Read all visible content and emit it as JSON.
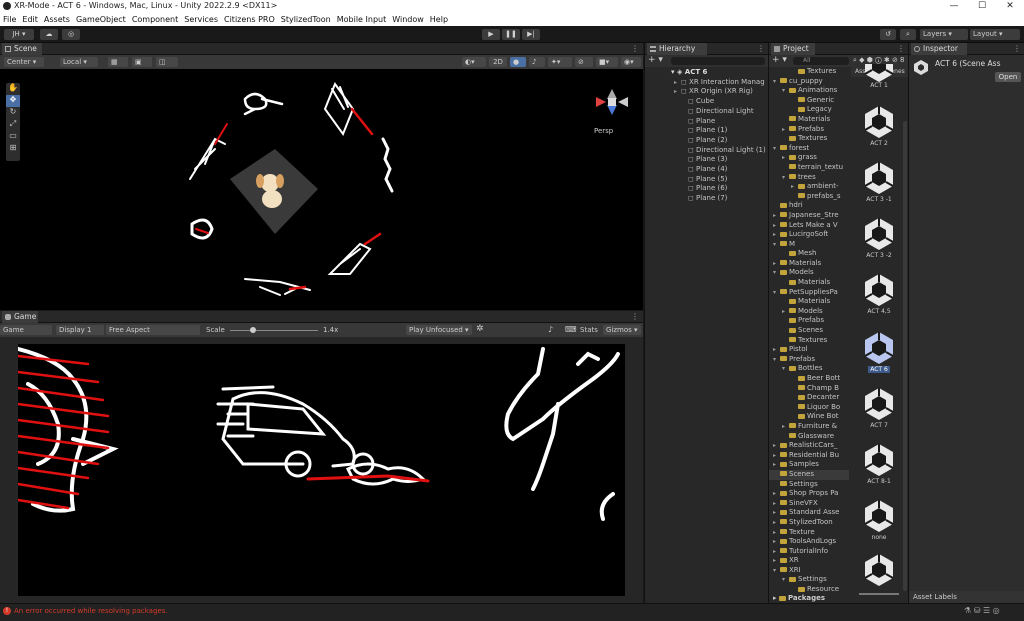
{
  "window": {
    "title": "XR-Mode - ACT 6 - Windows, Mac, Linux - Unity 2022.2.9 <DX11>"
  },
  "menu": [
    "File",
    "Edit",
    "Assets",
    "GameObject",
    "Component",
    "Services",
    "Citizens PRO",
    "StylizedToon",
    "Mobile Input",
    "Window",
    "Help"
  ],
  "toolbar": {
    "account": "JH ▾",
    "layers": "Layers",
    "layout": "Layout"
  },
  "scene": {
    "tab": "Scene",
    "pivot": "Center",
    "space": "Local",
    "mode_2d": "2D",
    "persp": "Persp"
  },
  "game": {
    "tab": "Game",
    "display_mode": "Game",
    "display": "Display 1",
    "aspect": "Free Aspect",
    "scale_label": "Scale",
    "scale_value": 1.4,
    "scale_text": "1.4x",
    "play_mode": "Play Unfocused",
    "stats": "Stats",
    "gizmos": "Gizmos"
  },
  "hierarchy": {
    "tab": "Hierarchy",
    "root": "ACT 6",
    "items": [
      "XR Interaction Manag",
      "XR Origin (XR Rig)",
      "Cube",
      "Directional Light",
      "Plane",
      "Plane (1)",
      "Plane (2)",
      "Directional Light (1)",
      "Plane (3)",
      "Plane (4)",
      "Plane (5)",
      "Plane (6)",
      "Plane (7)"
    ]
  },
  "project": {
    "tab": "Project",
    "search": "All",
    "breadcrumb": [
      "Assets",
      "Scenes"
    ],
    "tree": [
      {
        "label": "Textures",
        "d": 3,
        "a": ""
      },
      {
        "label": "cu_puppy",
        "d": 1,
        "a": "▾"
      },
      {
        "label": "Animations",
        "d": 2,
        "a": "▾"
      },
      {
        "label": "Generic",
        "d": 3,
        "a": ""
      },
      {
        "label": "Legacy",
        "d": 3,
        "a": ""
      },
      {
        "label": "Materials",
        "d": 2,
        "a": ""
      },
      {
        "label": "Prefabs",
        "d": 2,
        "a": "▸"
      },
      {
        "label": "Textures",
        "d": 2,
        "a": ""
      },
      {
        "label": "forest",
        "d": 1,
        "a": "▾"
      },
      {
        "label": "grass",
        "d": 2,
        "a": "▸"
      },
      {
        "label": "terrain_textu",
        "d": 2,
        "a": ""
      },
      {
        "label": "trees",
        "d": 2,
        "a": "▾"
      },
      {
        "label": "ambient-",
        "d": 3,
        "a": "▸"
      },
      {
        "label": "prefabs_s",
        "d": 3,
        "a": ""
      },
      {
        "label": "hdri",
        "d": 1,
        "a": ""
      },
      {
        "label": "Japanese_Stre",
        "d": 1,
        "a": "▸"
      },
      {
        "label": "Lets Make a V",
        "d": 1,
        "a": "▸"
      },
      {
        "label": "LucirgoSoft",
        "d": 1,
        "a": "▸"
      },
      {
        "label": "M",
        "d": 1,
        "a": "▾"
      },
      {
        "label": "Mesh",
        "d": 2,
        "a": ""
      },
      {
        "label": "Materials",
        "d": 1,
        "a": "▸"
      },
      {
        "label": "Models",
        "d": 1,
        "a": "▾"
      },
      {
        "label": "Materials",
        "d": 2,
        "a": ""
      },
      {
        "label": "PetSuppliesPa",
        "d": 1,
        "a": "▾"
      },
      {
        "label": "Materials",
        "d": 2,
        "a": ""
      },
      {
        "label": "Models",
        "d": 2,
        "a": "▸"
      },
      {
        "label": "Prefabs",
        "d": 2,
        "a": ""
      },
      {
        "label": "Scenes",
        "d": 2,
        "a": ""
      },
      {
        "label": "Textures",
        "d": 2,
        "a": ""
      },
      {
        "label": "Pistol",
        "d": 1,
        "a": "▸"
      },
      {
        "label": "Prefabs",
        "d": 1,
        "a": "▾"
      },
      {
        "label": "Bottles",
        "d": 2,
        "a": "▾"
      },
      {
        "label": "Beer Bott",
        "d": 3,
        "a": ""
      },
      {
        "label": "Champ B",
        "d": 3,
        "a": ""
      },
      {
        "label": "Decanter",
        "d": 3,
        "a": ""
      },
      {
        "label": "Liquor Bo",
        "d": 3,
        "a": ""
      },
      {
        "label": "Wine Bot",
        "d": 3,
        "a": ""
      },
      {
        "label": "Furniture &",
        "d": 2,
        "a": "▸"
      },
      {
        "label": "Glassware",
        "d": 2,
        "a": ""
      },
      {
        "label": "RealisticCars_",
        "d": 1,
        "a": "▸"
      },
      {
        "label": "Residential Bu",
        "d": 1,
        "a": "▸"
      },
      {
        "label": "Samples",
        "d": 1,
        "a": "▸"
      },
      {
        "label": "Scenes",
        "d": 1,
        "a": "",
        "sel": true
      },
      {
        "label": "Settings",
        "d": 1,
        "a": ""
      },
      {
        "label": "Shop Props Pa",
        "d": 1,
        "a": "▸"
      },
      {
        "label": "SineVFX",
        "d": 1,
        "a": "▸"
      },
      {
        "label": "Standard Asse",
        "d": 1,
        "a": "▸"
      },
      {
        "label": "StylizedToon",
        "d": 1,
        "a": "▸"
      },
      {
        "label": "Texture",
        "d": 1,
        "a": "▸"
      },
      {
        "label": "ToolsAndLogs",
        "d": 1,
        "a": "▸"
      },
      {
        "label": "TutorialInfo",
        "d": 1,
        "a": "▸"
      },
      {
        "label": "XR",
        "d": 1,
        "a": "▸"
      },
      {
        "label": "XRI",
        "d": 1,
        "a": "▾"
      },
      {
        "label": "Settings",
        "d": 2,
        "a": "▾"
      },
      {
        "label": "Resource",
        "d": 3,
        "a": ""
      }
    ],
    "packages": "Packages",
    "assets": [
      "ACT 1",
      "ACT 2",
      "ACT 3 -1",
      "ACT 3 -2",
      "ACT 4,5",
      "ACT 6",
      "ACT 7",
      "ACT 8-1",
      "none",
      ""
    ]
  },
  "inspector": {
    "tab": "Inspector",
    "title": "ACT 6 (Scene Ass",
    "open": "Open",
    "asset_labels": "Asset Labels"
  },
  "status": {
    "message": "An error occurred while resolving packages."
  }
}
